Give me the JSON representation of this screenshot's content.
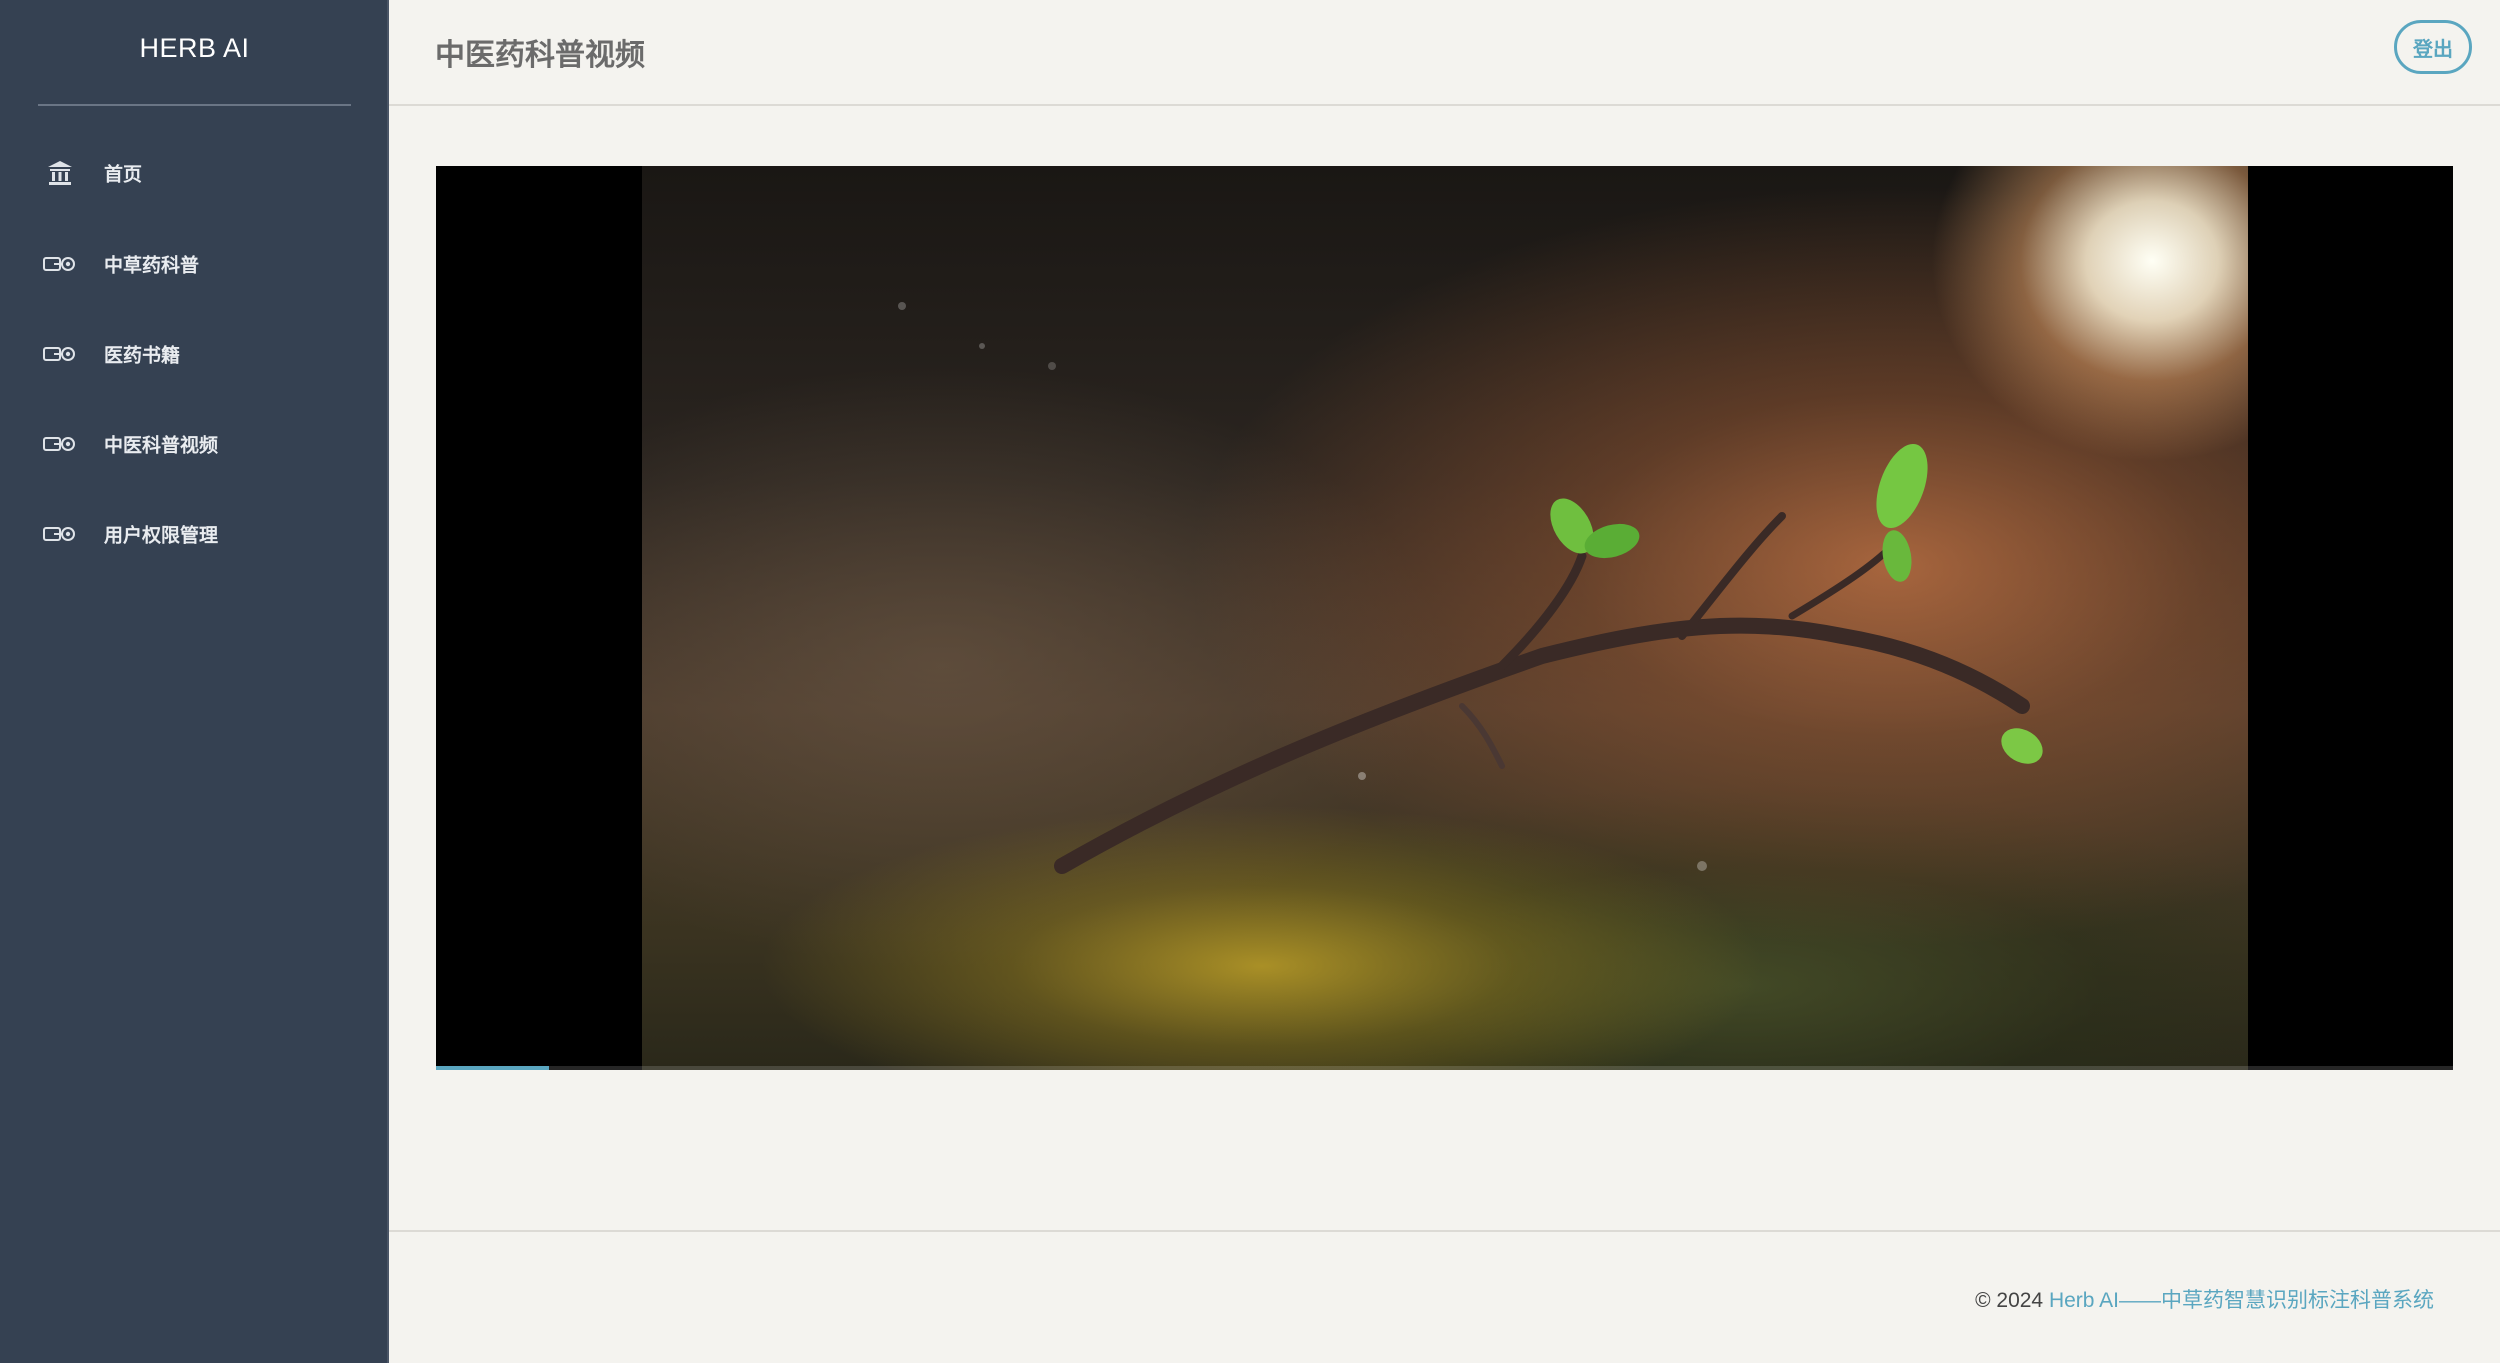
{
  "sidebar": {
    "brand": "HERB AI",
    "items": [
      {
        "label": "首页",
        "icon": "bank-icon"
      },
      {
        "label": "中草药科普",
        "icon": "link-arrow-icon"
      },
      {
        "label": "医药书籍",
        "icon": "link-arrow-icon"
      },
      {
        "label": "中医科普视频",
        "icon": "link-arrow-icon"
      },
      {
        "label": "用户权限管理",
        "icon": "link-arrow-icon"
      }
    ]
  },
  "header": {
    "title": "中医药科普视频",
    "logout_label": "登出"
  },
  "video": {
    "progress_fraction": 0.056
  },
  "footer": {
    "copyright": "© 2024",
    "link_text": "Herb AI——中草药智慧识别标注科普系统"
  },
  "colors": {
    "sidebar_bg": "#354152",
    "accent": "#5aa6c0",
    "page_bg": "#f4f3ef"
  }
}
